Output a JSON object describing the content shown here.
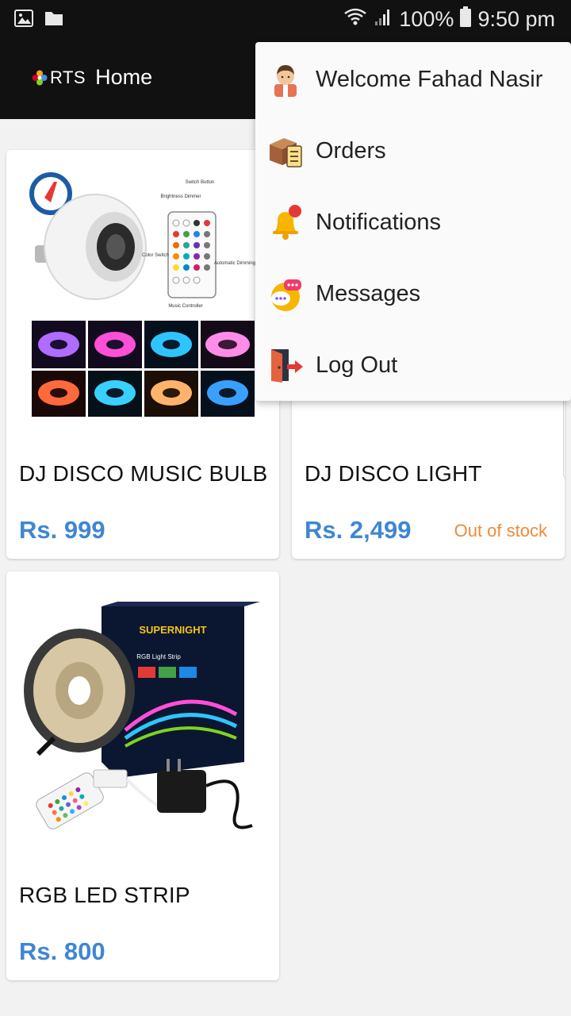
{
  "status_bar": {
    "battery": "100%",
    "time": "9:50 pm",
    "icons": [
      "gallery-icon",
      "folder-icon",
      "wifi-icon",
      "signal-icon",
      "battery-icon"
    ]
  },
  "app_bar": {
    "logo_text": "RTS",
    "title": "Home"
  },
  "menu": {
    "items": [
      {
        "label": "Welcome Fahad Nasir",
        "icon": "user-avatar-icon"
      },
      {
        "label": "Orders",
        "icon": "orders-box-icon"
      },
      {
        "label": "Notifications",
        "icon": "bell-icon"
      },
      {
        "label": "Messages",
        "icon": "chat-icon"
      },
      {
        "label": "Log Out",
        "icon": "logout-door-icon"
      }
    ]
  },
  "products": [
    {
      "name": "DJ DISCO MUSIC BULB",
      "price": "Rs. 999",
      "stock": ""
    },
    {
      "name": "DJ DISCO LIGHT",
      "price": "Rs. 2,499",
      "stock": "Out of stock"
    },
    {
      "name": "RGB LED STRIP",
      "price": "Rs. 800",
      "stock": ""
    }
  ],
  "image_text": {
    "remote_switch": "Switch Button",
    "remote_brightness": "Brightness Dimmer",
    "remote_color": "Color Switch",
    "remote_auto": "Automatic Dimming Key",
    "remote_music": "Music Controller",
    "strip_brand": "SUPERNIGHT",
    "strip_sub": "RGB Light Strip"
  },
  "colors": {
    "price_blue": "#3f86d3",
    "out_of_stock_orange": "#ef8a3a",
    "app_bar_bg": "#111111",
    "notification_dot": "#e53935"
  }
}
